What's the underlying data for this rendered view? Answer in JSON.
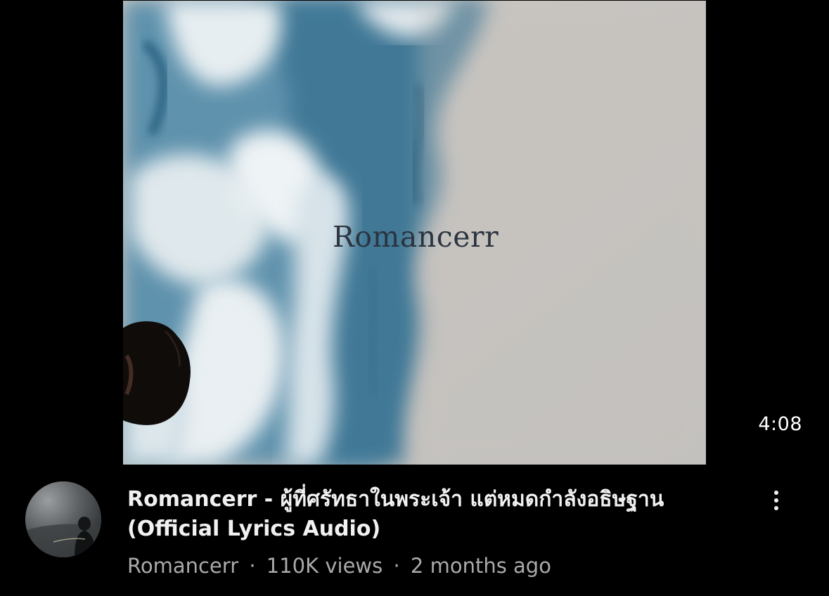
{
  "video": {
    "thumbnail_text": "Romancerr",
    "duration": "4:08",
    "title_line1": "Romancerr - ผู้ที่ศรัทธาในพระเจ้า แต่หมดกำลังอธิษฐาน",
    "title_line2": "(Official Lyrics Audio)",
    "channel": "Romancerr",
    "separator": "·",
    "views": "110K views",
    "age": "2 months ago"
  },
  "icons": {
    "menu": "more-vert-icon",
    "avatar": "channel-avatar"
  },
  "colors": {
    "background": "#000000",
    "title": "#f1f1f1",
    "secondary_text": "#aaaaaa",
    "art_paper": "#c6c3bf",
    "art_sky": "#4d87a3"
  }
}
